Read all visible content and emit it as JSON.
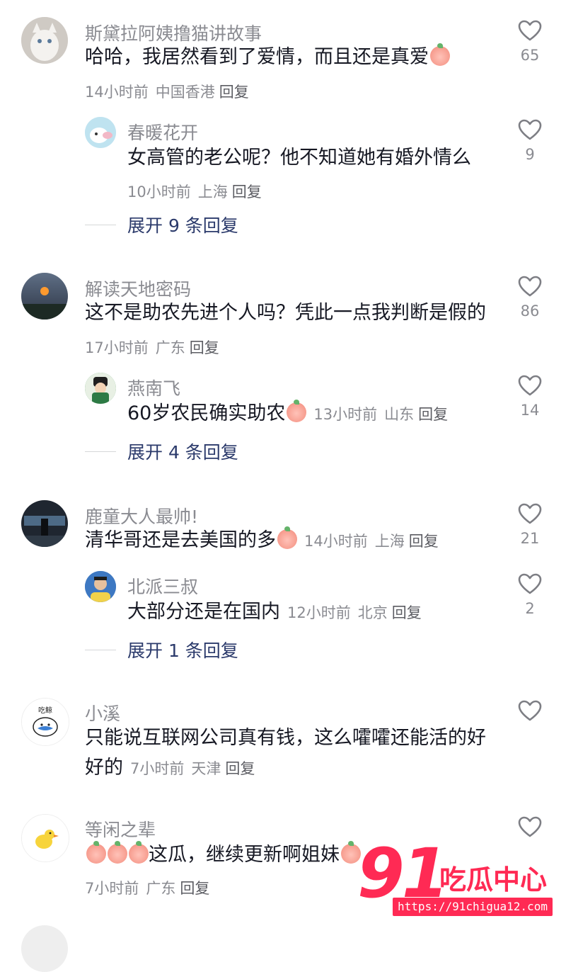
{
  "comments": [
    {
      "name": "斯黛拉阿姨撸猫讲故事",
      "text": "哈哈，我居然看到了爱情，而且还是真爱",
      "time": "14小时前",
      "location": "中国香港",
      "reply": "回复",
      "likes": "65",
      "avatar": "white-cat-avatar",
      "replies": [
        {
          "name": "春暖花开",
          "text": "女高管的老公呢？他不知道她有婚外情么",
          "time": "10小时前",
          "location": "上海",
          "reply": "回复",
          "likes": "9",
          "avatar": "cartoon-sheep-avatar"
        }
      ],
      "expand": "展开 9 条回复"
    },
    {
      "name": "解读天地密码",
      "text": "这不是助农先进个人吗？凭此一点我判断是假的",
      "time": "17小时前",
      "location": "广东",
      "reply": "回复",
      "likes": "86",
      "avatar": "sky-lantern-avatar",
      "replies": [
        {
          "name": "燕南飞",
          "text": "60岁农民确实助农",
          "time": "13小时前",
          "location": "山东",
          "reply": "回复",
          "likes": "14",
          "avatar": "green-character-avatar"
        }
      ],
      "expand": "展开 4 条回复"
    },
    {
      "name": "鹿童大人最帅!",
      "text": "清华哥还是去美国的多",
      "time": "14小时前",
      "location": "上海",
      "reply": "回复",
      "likes": "21",
      "avatar": "night-scene-avatar",
      "replies": [
        {
          "name": "北派三叔",
          "text": "大部分还是在国内",
          "time": "12小时前",
          "location": "北京",
          "reply": "回复",
          "likes": "2",
          "avatar": "man-portrait-avatar"
        }
      ],
      "expand": "展开 1 条回复"
    },
    {
      "name": "小溪",
      "text_line1": "只能说互联网公司真有钱，这么嚯嚯还能活的好",
      "text_line2": "好的",
      "time": "7小时前",
      "location": "天津",
      "reply": "回复",
      "likes": "",
      "avatar": "whale-sticker-avatar",
      "avatar_text": "吃鲸"
    },
    {
      "name": "等闲之辈",
      "text": "这瓜，继续更新啊姐妹",
      "time": "7小时前",
      "location": "广东",
      "reply": "回复",
      "likes": "",
      "avatar": "yellow-duck-avatar"
    }
  ],
  "watermark": {
    "number": "91",
    "brand": "吃瓜中心",
    "url": "https://91chigua12.com"
  },
  "colors": {
    "text": "#161823",
    "secondary": "#8a8b91",
    "expand": "#2b3a6b",
    "watermark": "#ff2a54"
  }
}
